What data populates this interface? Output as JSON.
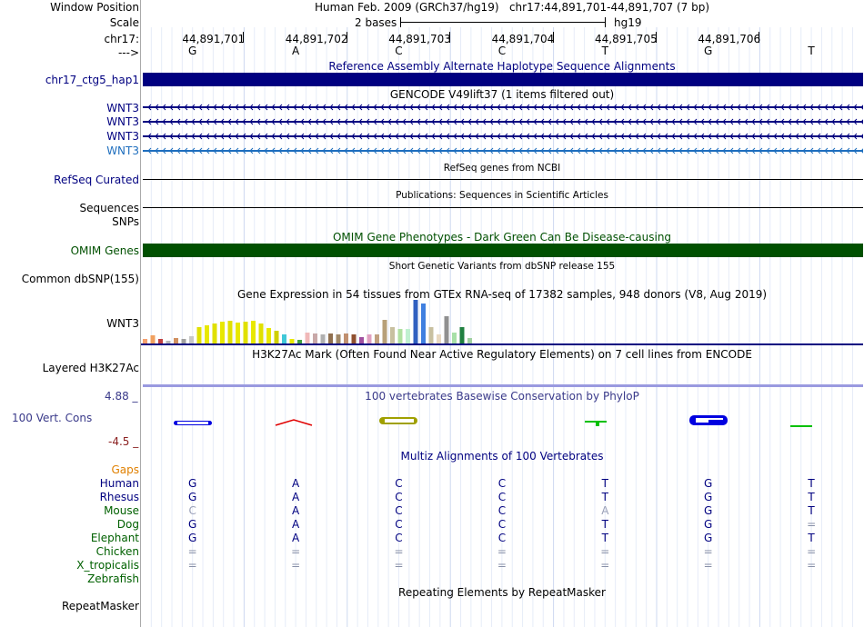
{
  "header": {
    "window_position_label": "Window Position",
    "scale_label": "Scale",
    "chrom_label": "chr17:",
    "strand_label": "--->",
    "position_text": "Human Feb. 2009 (GRCh37/hg19)   chr17:44,891,701-44,891,707 (7 bp)",
    "scale_text": "2 bases",
    "scale_db": "hg19",
    "coords": [
      "44,891,701",
      "44,891,702",
      "44,891,703",
      "44,891,704",
      "44,891,705",
      "44,891,706"
    ],
    "bases": [
      "G",
      "A",
      "C",
      "C",
      "T",
      "G",
      "T"
    ]
  },
  "tracks": {
    "hap_title": "Reference Assembly Alternate Haplotype Sequence Alignments",
    "hap_label": "chr17_ctg5_hap1",
    "gencode_title": "GENCODE V49lift37 (1 items filtered out)",
    "gencode_genes": [
      "WNT3",
      "WNT3",
      "WNT3",
      "WNT3"
    ],
    "refseq_title": "RefSeq genes from NCBI",
    "refseq_label": "RefSeq Curated",
    "pubs_title": "Publications: Sequences in Scientific Articles",
    "pubs_label": "Sequences",
    "snps_label": "SNPs",
    "omim_title": "OMIM Gene Phenotypes - Dark Green Can Be Disease-causing",
    "omim_label": "OMIM Genes",
    "dbsnp_title": "Short Genetic Variants from dbSNP release 155",
    "dbsnp_label": "Common dbSNP(155)",
    "gtex_title": "Gene Expression in 54 tissues from GTEx RNA-seq of 17382 samples, 948 donors (V8, Aug 2019)",
    "gtex_label": "WNT3",
    "h3k_title": "H3K27Ac Mark (Often Found Near Active Regulatory Elements) on 7 cell lines from ENCODE",
    "h3k_label": "Layered H3K27Ac",
    "phylop_title": "100 vertebrates Basewise Conservation by PhyloP",
    "phylop_label": "100 Vert. Cons",
    "phylop_max": "4.88 _",
    "phylop_min": "-4.5 _",
    "multiz_title": "Multiz Alignments of 100 Vertebrates",
    "gaps_label": "Gaps",
    "repeat_title": "Repeating Elements by RepeatMasker",
    "repeat_label": "RepeatMasker"
  },
  "species": [
    {
      "name": "Human",
      "color": "#000080",
      "bases": [
        "G",
        "A",
        "C",
        "C",
        "T",
        "G",
        "T"
      ]
    },
    {
      "name": "Rhesus",
      "color": "#000080",
      "bases": [
        "G",
        "A",
        "C",
        "C",
        "T",
        "G",
        "T"
      ]
    },
    {
      "name": "Mouse",
      "color": "#006000",
      "bases": [
        "C",
        "A",
        "C",
        "C",
        "A",
        "G",
        "T"
      ]
    },
    {
      "name": "Dog",
      "color": "#006000",
      "bases": [
        "G",
        "A",
        "C",
        "C",
        "T",
        "G",
        "="
      ]
    },
    {
      "name": "Elephant",
      "color": "#006000",
      "bases": [
        "G",
        "A",
        "C",
        "C",
        "T",
        "G",
        "T"
      ]
    },
    {
      "name": "Chicken",
      "color": "#006000",
      "bases": [
        "=",
        "=",
        "=",
        "=",
        "=",
        "=",
        "="
      ]
    },
    {
      "name": "X_tropicalis",
      "color": "#006000",
      "bases": [
        "=",
        "=",
        "=",
        "=",
        "=",
        "=",
        "="
      ]
    },
    {
      "name": "Zebrafish",
      "color": "#006000",
      "bases": [
        "",
        "",
        "",
        "",
        "",
        "",
        ""
      ]
    }
  ],
  "colors": {
    "navy": "#000080",
    "omim_green": "#005000",
    "label_blue": "#000080",
    "wnt3_light": "#1e6ebe",
    "gaps_orange": "#e08000",
    "phylop_title": "#3a3a8a",
    "phylop_min": "#8b2020"
  }
}
